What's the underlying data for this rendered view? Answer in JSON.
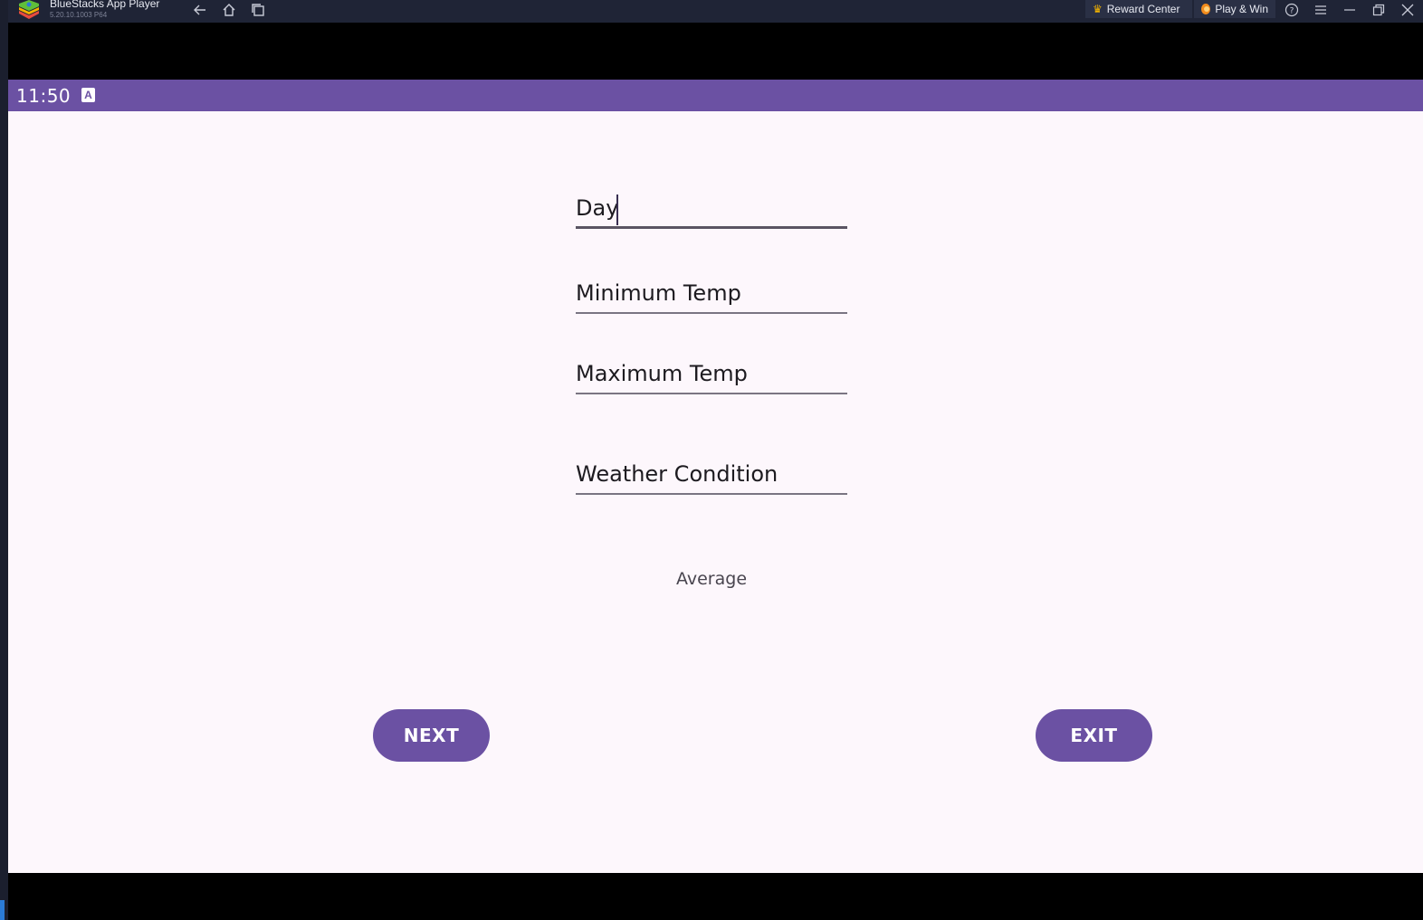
{
  "titlebar": {
    "app_name": "BlueStacks App Player",
    "version": "5.20.10.1003  P64",
    "reward_center": "Reward Center",
    "play_win": "Play & Win"
  },
  "statusbar": {
    "time": "11:50",
    "notification_icon": "A"
  },
  "form": {
    "day_value": "Day",
    "min_temp_placeholder": "Minimum Temp",
    "max_temp_placeholder": "Maximum Temp",
    "weather_placeholder": "Weather Condition",
    "average_label": "Average"
  },
  "buttons": {
    "next_label": "NEXT",
    "exit_label": "EXIT"
  },
  "colors": {
    "accent": "#6b51a3",
    "background": "#fdf7fc",
    "titlebar": "#1f2436"
  }
}
